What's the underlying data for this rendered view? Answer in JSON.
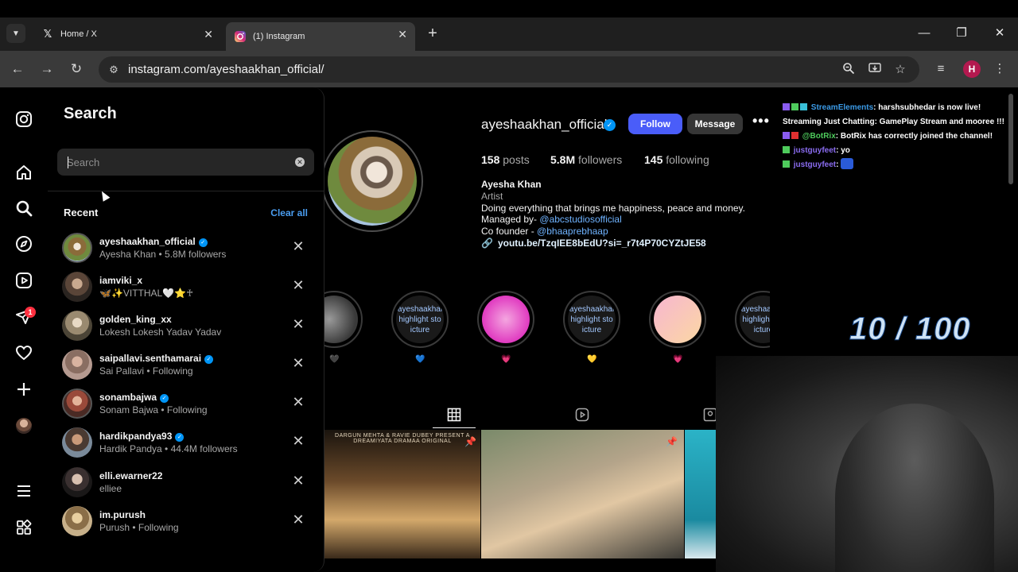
{
  "browser": {
    "tabs": [
      {
        "title": "Home / X",
        "favicon": "x-logo-icon"
      },
      {
        "title": "(1) Instagram",
        "favicon": "instagram-icon",
        "active": true
      }
    ],
    "url": "instagram.com/ayeshaakhan_official/",
    "profile_initial": "H"
  },
  "rail": {
    "notification_count": "1"
  },
  "search": {
    "title": "Search",
    "placeholder": "Search",
    "recent_label": "Recent",
    "clear_all": "Clear all",
    "recent": [
      {
        "username": "ayeshaakhan_official",
        "verified": true,
        "subtitle": "Ayesha Khan • 5.8M followers"
      },
      {
        "username": "iamviki_x",
        "verified": false,
        "subtitle": "🦋✨VITTHAL🤍⭐♰"
      },
      {
        "username": "golden_king_xx",
        "verified": false,
        "subtitle": "Lokesh Lokesh Yadav Yadav"
      },
      {
        "username": "saipallavi.senthamarai",
        "verified": true,
        "subtitle": "Sai Pallavi • Following"
      },
      {
        "username": "sonambajwa",
        "verified": true,
        "subtitle": "Sonam Bajwa • Following"
      },
      {
        "username": "hardikpandya93",
        "verified": true,
        "subtitle": "Hardik Pandya • 44.4M followers"
      },
      {
        "username": "elli.ewarner22",
        "verified": false,
        "subtitle": "elliee"
      },
      {
        "username": "im.purush",
        "verified": false,
        "subtitle": "Purush • Following"
      }
    ]
  },
  "profile": {
    "username": "ayeshaakhan_official",
    "follow_label": "Follow",
    "message_label": "Message",
    "posts_count": "158",
    "posts_label": "posts",
    "followers_count": "5.8M",
    "followers_label": "followers",
    "following_count": "145",
    "following_label": "following",
    "name": "Ayesha Khan",
    "category": "Artist",
    "bio_line1": "Doing everything that brings me happiness, peace and money.",
    "bio_line2_prefix": "Managed by- ",
    "bio_line2_mention": "@abcstudiosofficial",
    "bio_line3_prefix": "Co founder - ",
    "bio_line3_mention": "@bhaaprebhaap",
    "link": "youtu.be/TzqIEE8bEdU?si=_r7t4P70CYZtJE58",
    "highlights": [
      {
        "label": "",
        "heart": "🖤"
      },
      {
        "label": "ayeshaakhai highlight sto icture",
        "heart": "💙"
      },
      {
        "label": "",
        "heart": "💗"
      },
      {
        "label": "ayeshaakhai highlight sto icture",
        "heart": "💛"
      },
      {
        "label": "",
        "heart": "💗"
      },
      {
        "label": "ayeshaakhai highlight sto icture",
        "heart": ""
      },
      {
        "label": "ayeshaakhai highlight sto icture",
        "heart": ""
      }
    ],
    "post1_title": "DARGUN MEHTA & RAVIE DUBEY PRESENT A DREAMIYATA DRAMAA ORIGINAL"
  },
  "stream": {
    "chat": [
      {
        "user": "StreamElements",
        "text": ": harshsubhedar is now live! Streaming Just Chatting: GamePlay Stream and mooree !!!"
      },
      {
        "user": "@BotRix",
        "text": ": BotRix has correctly joined the channel!"
      },
      {
        "user": "justguyfeet",
        "text": ": yo"
      },
      {
        "user": "justguyfeet",
        "text": ":"
      }
    ],
    "counter": "10 / 100"
  }
}
